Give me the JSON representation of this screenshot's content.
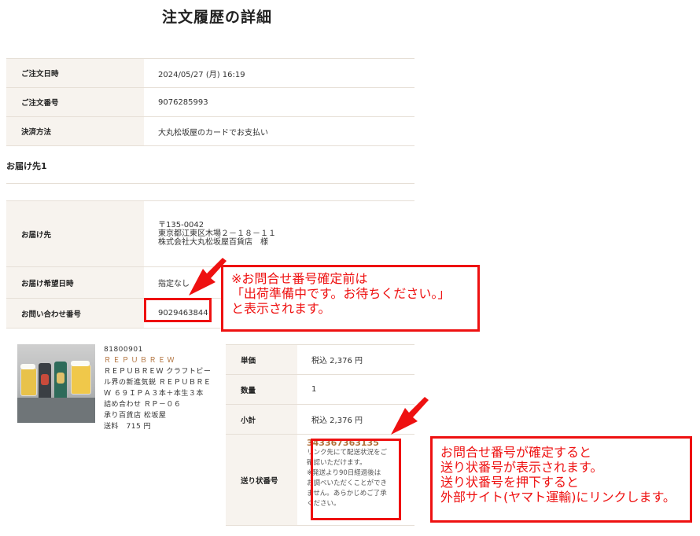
{
  "page": {
    "title": "注文履歴の詳細"
  },
  "order": [
    {
      "label": "ご注文日時",
      "value": "2024/05/27 (月) 16:19"
    },
    {
      "label": "ご注文番号",
      "value": "9076285993"
    },
    {
      "label": "決済方法",
      "value": "大丸松坂屋のカードでお支払い"
    }
  ],
  "shipping": {
    "section_title": "お届け先1",
    "address_label": "お届け先",
    "address_lines": [
      "〒135-0042",
      "東京都江東区木場２－１８－１１",
      "株式会社大丸松坂屋百貨店　様"
    ],
    "date_label": "お届け希望日時",
    "date_value": "指定なし",
    "inquiry_label": "お問い合わせ番号",
    "inquiry_value": "9029463844"
  },
  "product": {
    "code": "81800901",
    "brand": "ＲＥＰＵＢＲＥＷ",
    "desc_lines": [
      "ＲＥＰＵＢＲＥＷ クラフトビー",
      "ル界の新進気鋭 ＲＥＰＵＢＲＥ",
      "Ｗ ６９ＩＰＡ３本＋本生３本",
      "詰め合わせ ＲＰ－０６"
    ],
    "store": "承り百貨店 松坂屋",
    "shipping_fee": "送料　715 円"
  },
  "price": {
    "unit_label": "単価",
    "unit_value": "税込 2,376 円",
    "qty_label": "数量",
    "qty_value": "1",
    "subtotal_label": "小計",
    "subtotal_value": "税込 2,376 円",
    "tracking_label": "送り状番号",
    "tracking_number": "343367363135",
    "tracking_notes": [
      "リンク先にて配送状況をご",
      "確認いただけます。",
      "※発送より90日経過後は",
      "お調べいただくことができ",
      "ません。あらかじめご了承",
      "ください。"
    ]
  },
  "annotations": {
    "callout1": [
      "※お問合せ番号確定前は",
      "「出荷準備中です。お待ちください。」",
      "と表示されます。"
    ],
    "callout2": [
      "お問合せ番号が確定すると",
      "送り状番号が表示されます。",
      "送り状番号を押下すると",
      "外部サイト(ヤマト運輸)にリンクします。"
    ]
  },
  "colors": {
    "accent_red": "#ee1111",
    "brand_brown": "#b0703a",
    "label_bg": "#f7f3ee"
  }
}
